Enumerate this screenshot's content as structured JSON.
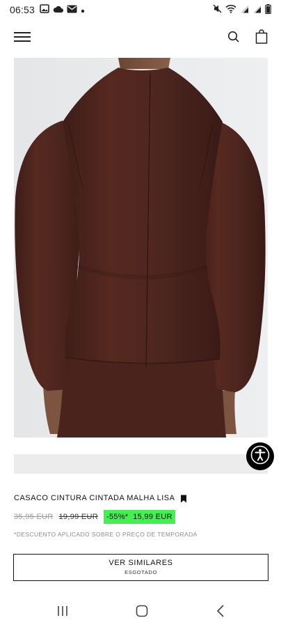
{
  "status_bar": {
    "time": "06:53",
    "left_icons": [
      "image-icon",
      "cloud-icon",
      "mail-icon",
      "dot-icon"
    ],
    "right_icons": [
      "mute-icon",
      "wifi-icon",
      "signal-icon",
      "signal-icon",
      "battery-icon"
    ]
  },
  "header": {
    "menu_icon": "hamburger-menu-icon",
    "search_icon": "search-icon",
    "bag_icon": "shopping-bag-icon"
  },
  "product": {
    "name": "CASACO CINTURA CINTADA MALHA LISA",
    "bookmark_icon": "bookmark-icon",
    "price_original": "35,95 EUR",
    "price_previous": "19,99 EUR",
    "price_sale": "-55%*  15,99 EUR",
    "discount_note": "*DESCUENTO APLICADO SOBRE O PREÇO DE TEMPORADA",
    "similar_button": {
      "label": "VER SIMILARES",
      "sublabel": "ESGOTADO"
    }
  },
  "accessibility": {
    "icon": "accessibility-icon"
  },
  "nav_bar": {
    "recents_icon": "recent-apps-icon",
    "home_icon": "home-icon",
    "back_icon": "back-icon"
  },
  "colors": {
    "sale_highlight": "#41f14f",
    "garment": "#4a231e",
    "background": "#ffffff"
  }
}
